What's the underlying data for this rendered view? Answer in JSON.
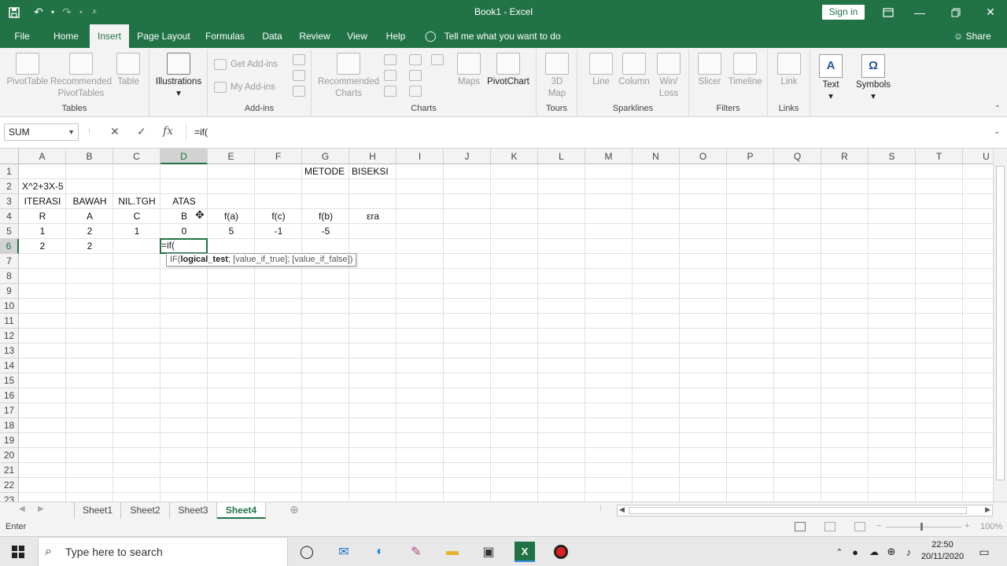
{
  "window": {
    "title": "Book1  -  Excel",
    "sign_in": "Sign in"
  },
  "ribbon_tabs": [
    "File",
    "Home",
    "Insert",
    "Page Layout",
    "Formulas",
    "Data",
    "Review",
    "View",
    "Help"
  ],
  "active_tab": "Insert",
  "tell_me": "Tell me what you want to do",
  "share": "Share",
  "ribbon": {
    "tables": {
      "label": "Tables",
      "pivot": "PivotTable",
      "rec_pivot_1": "Recommended",
      "rec_pivot_2": "PivotTables",
      "table": "Table"
    },
    "illustrations": {
      "label": "Illustrations"
    },
    "addins": {
      "label": "Add-ins",
      "get": "Get Add-ins",
      "my": "My Add-ins"
    },
    "charts": {
      "label": "Charts",
      "rec_1": "Recommended",
      "rec_2": "Charts",
      "maps": "Maps",
      "pivotchart": "PivotChart"
    },
    "tours": {
      "label": "Tours",
      "map3d_1": "3D",
      "map3d_2": "Map"
    },
    "sparklines": {
      "label": "Sparklines",
      "line": "Line",
      "column": "Column",
      "winloss_1": "Win/",
      "winloss_2": "Loss"
    },
    "filters": {
      "label": "Filters",
      "slicer": "Slicer",
      "timeline": "Timeline"
    },
    "links": {
      "label": "Links",
      "link": "Link"
    },
    "text": {
      "label": "Text"
    },
    "symbols": {
      "label": "Symbols",
      "omega": "Ω"
    }
  },
  "formula_bar": {
    "name_box": "SUM",
    "cancel": "✕",
    "enter": "✓",
    "fx": "fx",
    "formula": "=if("
  },
  "columns": [
    "A",
    "B",
    "C",
    "D",
    "E",
    "F",
    "G",
    "H",
    "I",
    "J",
    "K",
    "L",
    "M",
    "N",
    "O",
    "P",
    "Q",
    "R",
    "S",
    "T",
    "U"
  ],
  "rows": [
    "1",
    "2",
    "3",
    "4",
    "5",
    "6",
    "7",
    "8",
    "9",
    "10",
    "11",
    "12",
    "13",
    "14",
    "15",
    "16",
    "17",
    "18",
    "19",
    "20",
    "21",
    "22",
    "23"
  ],
  "cells": {
    "G1": "METODE",
    "H1": "BISEKSI",
    "A2": "X^2+3X-5",
    "A3": "ITERASI",
    "B3": "BAWAH",
    "C3": "NIL.TGH",
    "D3": "ATAS",
    "A4": "R",
    "B4": "A",
    "C4": "C",
    "D4": "B",
    "E4": "f(a)",
    "F4": "f(c)",
    "G4": "f(b)",
    "H4": "εra",
    "A5": "1",
    "B5": "2",
    "C5": "1",
    "D5": "0",
    "E5": "5",
    "F5": "-1",
    "G5": "-5",
    "A6": "2",
    "B6": "2",
    "D6": "=if("
  },
  "tooltip": {
    "fn": "IF(",
    "bold_arg": "logical_test",
    "rest": "; [value_if_true]; [value_if_false])"
  },
  "sheets": [
    "Sheet1",
    "Sheet2",
    "Sheet3",
    "Sheet4"
  ],
  "active_sheet": "Sheet4",
  "status": {
    "mode": "Enter",
    "zoom": "100%"
  },
  "taskbar": {
    "search_placeholder": "Type here to search",
    "time": "22:50",
    "date": "20/11/2020"
  },
  "colors": {
    "excel_green": "#217346"
  }
}
